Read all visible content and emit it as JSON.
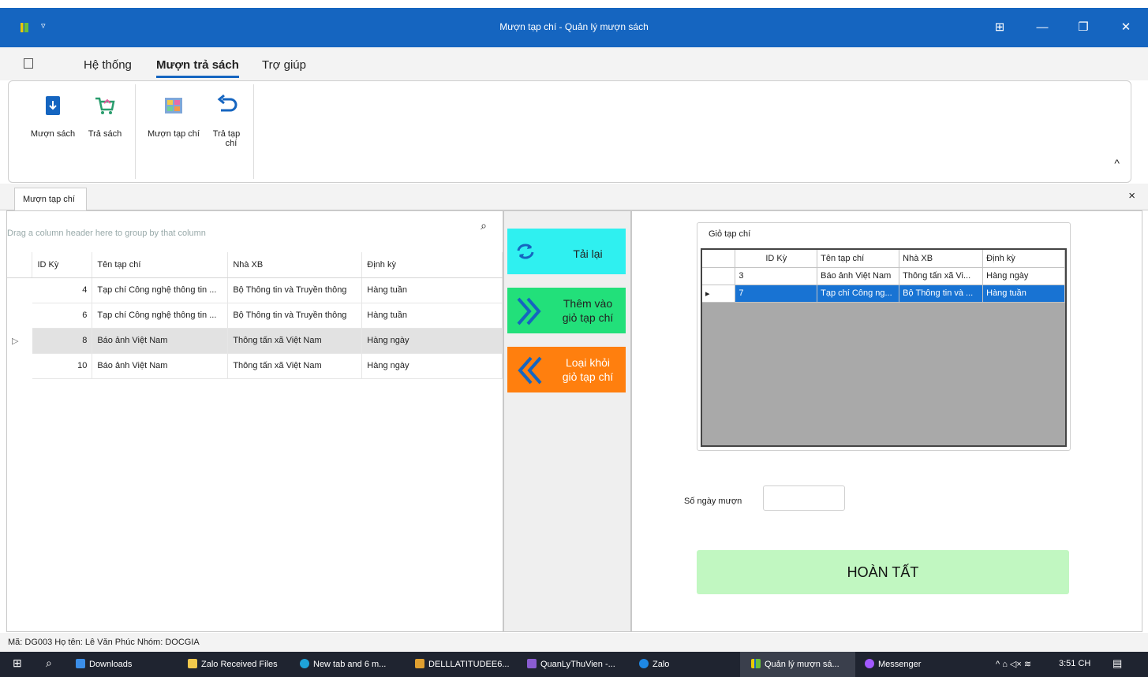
{
  "window": {
    "title": "Mượn tạp chí - Quản lý mượn sách",
    "qat": "▿"
  },
  "ribbon": {
    "tabs": [
      "Hệ thống",
      "Mượn trả sách",
      "Trợ giúp"
    ],
    "active_tab": "Mượn trả sách",
    "buttons": {
      "muon_sach": "Mượn sách",
      "tra_sach": "Trả sách",
      "muon_tap_chi": "Mượn tạp chí",
      "tra_tap_chi_1": "Trả tạp",
      "tra_tap_chi_2": "chí"
    },
    "collapse": "^"
  },
  "doc_tab": {
    "label": "Mượn tạp chí",
    "close": "×"
  },
  "main_grid": {
    "group_hint": "Drag a column header here to group by that column",
    "columns": [
      "ID Kỳ",
      "Tên tạp chí",
      "Nhà XB",
      "Định kỳ"
    ],
    "rows": [
      {
        "id": "4",
        "ten": "Tạp chí Công nghệ thông tin ...",
        "nxb": "Bộ Thông tin và Truyền thông",
        "dinhky": "Hàng tuần"
      },
      {
        "id": "6",
        "ten": "Tạp chí Công nghệ thông tin ...",
        "nxb": "Bộ Thông tin và Truyền thông",
        "dinhky": "Hàng tuần"
      },
      {
        "id": "8",
        "ten": "Báo ảnh Việt Nam",
        "nxb": "Thông tấn xã Việt Nam",
        "dinhky": "Hàng ngày"
      },
      {
        "id": "10",
        "ten": "Báo ảnh Việt Nam",
        "nxb": "Thông tấn xã Việt Nam",
        "dinhky": "Hàng ngày"
      }
    ],
    "selected_indicator": "▷"
  },
  "actions": {
    "reload": "Tải lại",
    "add_1": "Thêm vào",
    "add_2": "giỏ tạp chí",
    "remove_1": "Loại khỏi",
    "remove_2": "giỏ tạp chí"
  },
  "cart": {
    "title": "Giỏ tạp chí",
    "columns": [
      "ID Kỳ",
      "Tên tạp chí",
      "Nhà XB",
      "Định kỳ"
    ],
    "rows": [
      {
        "id": "3",
        "ten": "Báo ảnh Việt Nam",
        "nxb": "Thông tấn xã Vi...",
        "dinhky": "Hàng ngày"
      },
      {
        "id": "7",
        "ten": "Tạp chí Công ng...",
        "nxb": "Bộ Thông tin và ...",
        "dinhky": "Hàng tuần"
      }
    ],
    "row_indicator": "▸"
  },
  "borrow": {
    "days_label": "Số ngày mượn",
    "days_value": "",
    "finish": "HOÀN TẤT"
  },
  "status": "Mã: DG003  Họ tên: Lê Văn Phúc  Nhóm: DOCGIA",
  "taskbar": {
    "items": [
      "Downloads",
      "Zalo Received Files",
      "New tab and 6 m...",
      "DELLLATITUDEE6...",
      "QuanLyThuVien -...",
      "Zalo",
      "Quản lý mượn sá...",
      "Messenger"
    ],
    "tray": "^ ⌂ ◁× ≋",
    "clock": "3:51 CH"
  },
  "colors": {
    "titlebar": "#1565c0",
    "reload_btn": "#2ff0f0",
    "add_btn": "#22e07a",
    "remove_btn": "#ff7f0e",
    "finish_btn": "#c1f7c1",
    "cart_selected": "#1873d3"
  }
}
